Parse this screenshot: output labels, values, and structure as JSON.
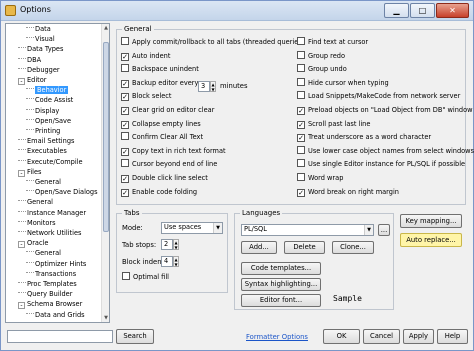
{
  "window": {
    "title": "Options"
  },
  "tree": {
    "items": [
      {
        "label": "Data",
        "indent": 2,
        "expander": ""
      },
      {
        "label": "Visual",
        "indent": 2,
        "expander": ""
      },
      {
        "label": "Data Types",
        "indent": 1,
        "expander": ""
      },
      {
        "label": "DBA",
        "indent": 1,
        "expander": ""
      },
      {
        "label": "Debugger",
        "indent": 1,
        "expander": ""
      },
      {
        "label": "Editor",
        "indent": 1,
        "expander": "-"
      },
      {
        "label": "Behavior",
        "indent": 2,
        "expander": "",
        "selected": true
      },
      {
        "label": "Code Assist",
        "indent": 2,
        "expander": ""
      },
      {
        "label": "Display",
        "indent": 2,
        "expander": ""
      },
      {
        "label": "Open/Save",
        "indent": 2,
        "expander": ""
      },
      {
        "label": "Printing",
        "indent": 2,
        "expander": ""
      },
      {
        "label": "Email Settings",
        "indent": 1,
        "expander": ""
      },
      {
        "label": "Executables",
        "indent": 1,
        "expander": ""
      },
      {
        "label": "Execute/Compile",
        "indent": 1,
        "expander": ""
      },
      {
        "label": "Files",
        "indent": 1,
        "expander": "-"
      },
      {
        "label": "General",
        "indent": 2,
        "expander": ""
      },
      {
        "label": "Open/Save Dialogs",
        "indent": 2,
        "expander": ""
      },
      {
        "label": "General",
        "indent": 1,
        "expander": ""
      },
      {
        "label": "Instance Manager",
        "indent": 1,
        "expander": ""
      },
      {
        "label": "Monitors",
        "indent": 1,
        "expander": ""
      },
      {
        "label": "Network Utilities",
        "indent": 1,
        "expander": ""
      },
      {
        "label": "Oracle",
        "indent": 1,
        "expander": "-"
      },
      {
        "label": "General",
        "indent": 2,
        "expander": ""
      },
      {
        "label": "Optimizer Hints",
        "indent": 2,
        "expander": ""
      },
      {
        "label": "Transactions",
        "indent": 2,
        "expander": ""
      },
      {
        "label": "Proc Templates",
        "indent": 1,
        "expander": ""
      },
      {
        "label": "Query Builder",
        "indent": 1,
        "expander": ""
      },
      {
        "label": "Schema Browser",
        "indent": 1,
        "expander": "-"
      },
      {
        "label": "Data and Grids",
        "indent": 2,
        "expander": ""
      }
    ]
  },
  "general": {
    "title": "General",
    "left": [
      {
        "label": "Apply commit/rollback to all tabs (threaded queries)",
        "checked": false
      },
      {
        "label": "Auto indent",
        "checked": true
      },
      {
        "label": "Backspace unindent",
        "checked": false
      },
      {
        "label": "Backup editor every",
        "checked": true
      },
      {
        "label": "Block select",
        "checked": true
      },
      {
        "label": "Clear grid on editor clear",
        "checked": true
      },
      {
        "label": "Collapse empty lines",
        "checked": true
      },
      {
        "label": "Confirm Clear All Text",
        "checked": false
      },
      {
        "label": "Copy text in rich text format",
        "checked": true
      },
      {
        "label": "Cursor beyond end of line",
        "checked": false
      },
      {
        "label": "Double click line select",
        "checked": true
      },
      {
        "label": "Enable code folding",
        "checked": true
      }
    ],
    "right": [
      {
        "label": "Find text at cursor",
        "checked": false
      },
      {
        "label": "Group redo",
        "checked": false
      },
      {
        "label": "Group undo",
        "checked": false
      },
      {
        "label": "Hide cursor when typing",
        "checked": false
      },
      {
        "label": "Load Snippets/MakeCode from network server",
        "checked": false
      },
      {
        "label": "Preload objects on \"Load Object from DB\" window",
        "checked": true
      },
      {
        "label": "Scroll past last line",
        "checked": true
      },
      {
        "label": "Treat underscore as a word character",
        "checked": true
      },
      {
        "label": "Use lower case object names from select windows",
        "checked": false
      },
      {
        "label": "Use single Editor instance for PL/SQL if possible",
        "checked": false
      },
      {
        "label": "Word wrap",
        "checked": false
      },
      {
        "label": "Word break on right margin",
        "checked": true
      }
    ],
    "backup_value": "3",
    "backup_unit": "minutes"
  },
  "tabs": {
    "title": "Tabs",
    "mode_label": "Mode:",
    "mode_value": "Use spaces",
    "tab_stops_label": "Tab stops:",
    "tab_stops_value": "2",
    "block_indent_label": "Block indent:",
    "block_indent_value": "4",
    "optimal_fill_label": "Optimal fill",
    "optimal_fill_checked": false
  },
  "languages": {
    "title": "Languages",
    "selected": "PL/SQL",
    "browse_label": "...",
    "add_label": "Add...",
    "delete_label": "Delete",
    "clone_label": "Clone...",
    "code_templates_label": "Code templates...",
    "syntax_highlighting_label": "Syntax highlighting...",
    "editor_font_label": "Editor font...",
    "sample_text": "Sample"
  },
  "side_buttons": {
    "key_mapping_label": "Key mapping...",
    "auto_replace_label": "Auto replace..."
  },
  "footer": {
    "search_value": "",
    "search_label": "Search",
    "formatter_link": "Formatter Options",
    "ok_label": "OK",
    "cancel_label": "Cancel",
    "apply_label": "Apply",
    "help_label": "Help"
  },
  "colors": {
    "selection": "#3399ff",
    "highlight_button": "#fff5a8",
    "link": "#1b55c8"
  }
}
